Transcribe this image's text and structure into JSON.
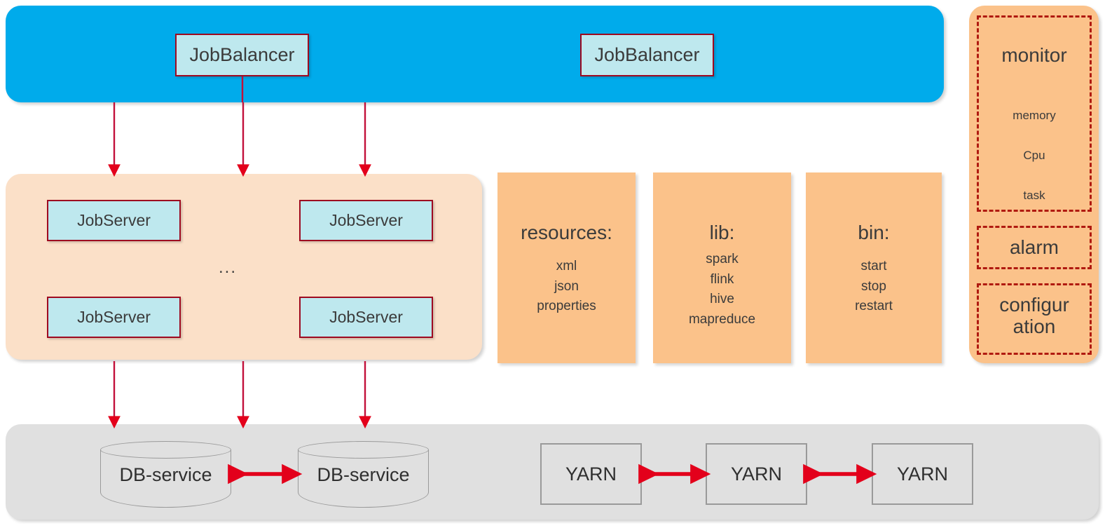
{
  "diagram": {
    "title": "JobBalancer / JobServer distributed scheduling architecture",
    "colors": {
      "balancer_band": "#00ABEB",
      "node_fill": "#BEE8EE",
      "node_border": "#9E0A20",
      "cluster_panel": "#FBE0C8",
      "module_panel": "#FBC28A",
      "infra_panel": "#E0E0E0",
      "arrow": "#E3001B",
      "dashed_border": "#B01A10"
    }
  },
  "balancer_layer": {
    "nodes": [
      {
        "label": "JobBalancer"
      },
      {
        "label": "JobBalancer"
      }
    ]
  },
  "cluster_layer": {
    "ellipsis": "...",
    "nodes": [
      {
        "label": "JobServer"
      },
      {
        "label": "JobServer"
      },
      {
        "label": "JobServer"
      },
      {
        "label": "JobServer"
      }
    ]
  },
  "modules": [
    {
      "title": "resources:",
      "items": [
        "xml",
        "json",
        "properties"
      ]
    },
    {
      "title": "lib:",
      "items": [
        "spark",
        "flink",
        "hive",
        "mapreduce"
      ]
    },
    {
      "title": "bin:",
      "items": [
        "start",
        "stop",
        "restart"
      ]
    }
  ],
  "sidebar": {
    "sections": [
      {
        "title": "monitor",
        "items": [
          "memory",
          "Cpu",
          "task"
        ]
      },
      {
        "title": "alarm",
        "items": []
      },
      {
        "title": "configur ation",
        "title_line1": "configur",
        "title_line2": "ation",
        "items": []
      }
    ]
  },
  "infra_layer": {
    "databases": [
      {
        "label": "DB-service"
      },
      {
        "label": "DB-service"
      }
    ],
    "resource_managers": [
      {
        "label": "YARN"
      },
      {
        "label": "YARN"
      },
      {
        "label": "YARN"
      }
    ]
  }
}
